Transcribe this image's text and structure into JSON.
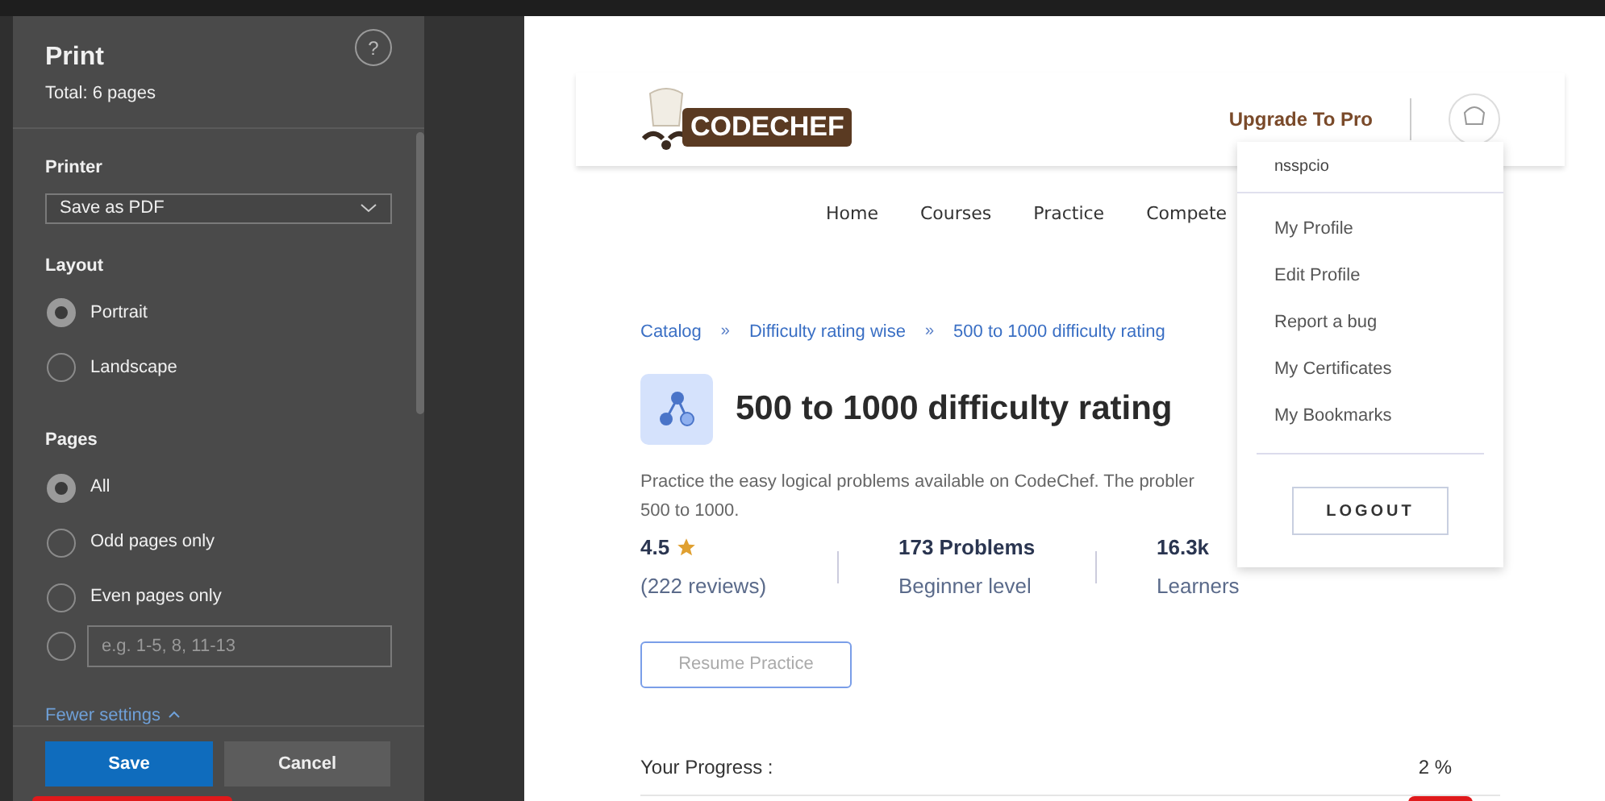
{
  "print_panel": {
    "title": "Print",
    "total": "Total: 6 pages",
    "help": "?",
    "printer": {
      "label": "Printer",
      "value": "Save as PDF"
    },
    "layout": {
      "label": "Layout",
      "options": [
        {
          "label": "Portrait",
          "selected": true
        },
        {
          "label": "Landscape",
          "selected": false
        }
      ]
    },
    "pages": {
      "label": "Pages",
      "options": [
        {
          "kind": "radio",
          "label": "All",
          "selected": true
        },
        {
          "kind": "radio",
          "label": "Odd pages only",
          "selected": false
        },
        {
          "kind": "radio",
          "label": "Even pages only",
          "selected": false
        },
        {
          "kind": "range",
          "placeholder": "e.g. 1-5, 8, 11-13",
          "selected": false
        }
      ]
    },
    "fewer_settings": "Fewer settings",
    "buttons": [
      {
        "kind": "primary",
        "label": "Save"
      },
      {
        "kind": "secondary",
        "label": "Cancel"
      }
    ]
  },
  "page": {
    "logo": "CODECHEF",
    "upgrade": "Upgrade To Pro",
    "nav": [
      "Home",
      "Courses",
      "Practice",
      "Compete"
    ],
    "breadcrumb": [
      {
        "kind": "link",
        "text": "Catalog"
      },
      {
        "kind": "separator",
        "text": "»"
      },
      {
        "kind": "link",
        "text": "Difficulty rating wise"
      },
      {
        "kind": "separator",
        "text": "» "
      },
      {
        "kind": "link",
        "text": "500 to 1000 difficulty rating"
      }
    ],
    "title": "500 to 1000 difficulty rating",
    "description": [
      "Practice the easy logical problems available on CodeChef. The probler",
      "500 to 1000."
    ],
    "stats": [
      {
        "kind": "rating",
        "value": "4.5",
        "label": "(222 reviews)"
      },
      {
        "kind": "plain",
        "value": "173 Problems",
        "label": "Beginner level"
      },
      {
        "kind": "plain",
        "value": "16.3k",
        "label": "Learners"
      }
    ],
    "resume": "Resume Practice",
    "progress": {
      "label": "Your Progress :",
      "value": "2 %"
    },
    "user_menu": {
      "username": "nsspcio",
      "items": [
        "My Profile",
        "Edit Profile",
        "Report a bug",
        "My Certificates",
        "My Bookmarks"
      ],
      "logout": "LOGOUT"
    }
  }
}
